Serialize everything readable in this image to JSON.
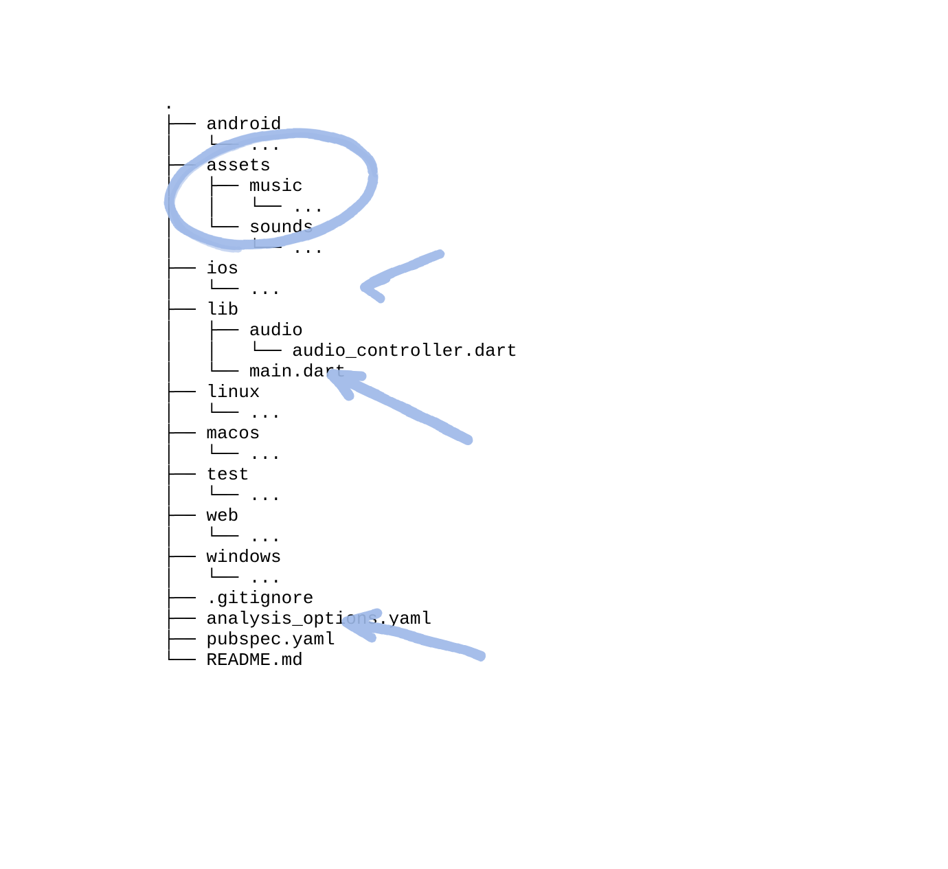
{
  "annotation_color": "#9db8e8",
  "tree": {
    "root": ".",
    "lines": [
      ".",
      "├── android",
      "│   └── ...",
      "├── assets",
      "│   ├── music",
      "│   │   └── ...",
      "│   └── sounds",
      "│       └── ...",
      "├── ios",
      "│   └── ...",
      "├── lib",
      "│   ├── audio",
      "│   │   └── audio_controller.dart",
      "│   └── main.dart",
      "├── linux",
      "│   └── ...",
      "├── macos",
      "│   └── ...",
      "├── test",
      "│   └── ...",
      "├── web",
      "│   └── ...",
      "├── windows",
      "│   └── ...",
      "├── .gitignore",
      "├── analysis_options.yaml",
      "├── pubspec.yaml",
      "└── README.md"
    ],
    "nodes": [
      {
        "name": ".",
        "depth": 0,
        "type": "dir"
      },
      {
        "name": "android",
        "depth": 1,
        "type": "dir",
        "children_elided": true
      },
      {
        "name": "assets",
        "depth": 1,
        "type": "dir",
        "children": [
          {
            "name": "music",
            "depth": 2,
            "type": "dir",
            "children_elided": true
          },
          {
            "name": "sounds",
            "depth": 2,
            "type": "dir",
            "children_elided": true
          }
        ]
      },
      {
        "name": "ios",
        "depth": 1,
        "type": "dir",
        "children_elided": true
      },
      {
        "name": "lib",
        "depth": 1,
        "type": "dir",
        "children": [
          {
            "name": "audio",
            "depth": 2,
            "type": "dir",
            "children": [
              {
                "name": "audio_controller.dart",
                "depth": 3,
                "type": "file"
              }
            ]
          },
          {
            "name": "main.dart",
            "depth": 2,
            "type": "file"
          }
        ]
      },
      {
        "name": "linux",
        "depth": 1,
        "type": "dir",
        "children_elided": true
      },
      {
        "name": "macos",
        "depth": 1,
        "type": "dir",
        "children_elided": true
      },
      {
        "name": "test",
        "depth": 1,
        "type": "dir",
        "children_elided": true
      },
      {
        "name": "web",
        "depth": 1,
        "type": "dir",
        "children_elided": true
      },
      {
        "name": "windows",
        "depth": 1,
        "type": "dir",
        "children_elided": true
      },
      {
        "name": ".gitignore",
        "depth": 1,
        "type": "file"
      },
      {
        "name": "analysis_options.yaml",
        "depth": 1,
        "type": "file"
      },
      {
        "name": "pubspec.yaml",
        "depth": 1,
        "type": "file"
      },
      {
        "name": "README.md",
        "depth": 1,
        "type": "file"
      }
    ]
  },
  "annotations": [
    {
      "kind": "circle",
      "target": "assets"
    },
    {
      "kind": "arrow",
      "target": "lib"
    },
    {
      "kind": "arrow",
      "target": "main.dart"
    },
    {
      "kind": "arrow",
      "target": "pubspec.yaml"
    }
  ]
}
